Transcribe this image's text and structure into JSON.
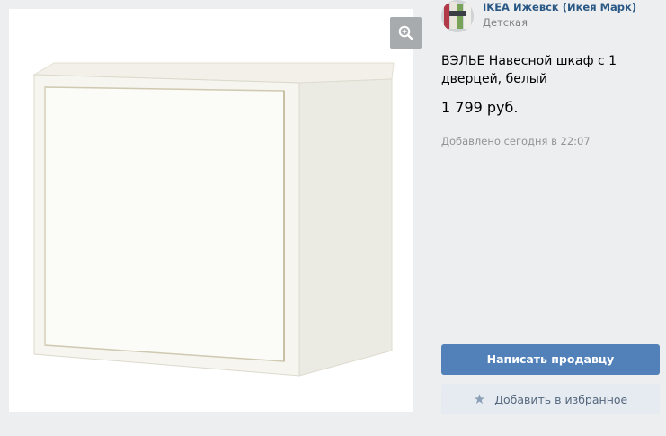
{
  "photo": {
    "zoom_icon": "magnifier-plus-icon"
  },
  "seller": {
    "name": "IKEA Ижевск (Икея Марк)",
    "category": "Детская"
  },
  "product": {
    "title": "ВЭЛЬЕ Навесной шкаф с 1 дверцей, белый",
    "price": "1 799 руб.",
    "added": "Добавлено сегодня в 22:07"
  },
  "actions": {
    "contact_label": "Написать продавцу",
    "favorite_label": "Добавить в избранное",
    "favorite_icon": "star-icon"
  },
  "colors": {
    "page_bg": "#edeef0",
    "link": "#2a5885",
    "primary_button": "#5181b8",
    "secondary_button": "#e5ebf1"
  }
}
